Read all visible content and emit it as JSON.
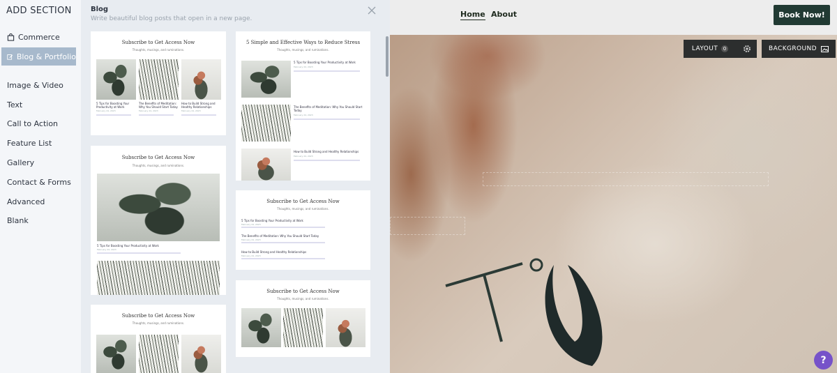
{
  "sidebar": {
    "title": "ADD SECTION",
    "items": [
      {
        "label": "Commerce",
        "icon": "bag-icon"
      },
      {
        "label": "Blog & Portfolio",
        "icon": "edit-icon",
        "active": true
      },
      {
        "label": "Image & Video"
      },
      {
        "label": "Text"
      },
      {
        "label": "Call to Action"
      },
      {
        "label": "Feature List"
      },
      {
        "label": "Gallery"
      },
      {
        "label": "Contact & Forms"
      },
      {
        "label": "Advanced"
      },
      {
        "label": "Blank"
      }
    ]
  },
  "panel": {
    "title": "Blog",
    "subtitle": "Write beautiful blog posts that open in a new page.",
    "cards": {
      "c1": {
        "title": "Subscribe to Get Access Now",
        "sub": "Thoughts, musings, and ruminations.",
        "posts": [
          {
            "title": "5 Tips for Boosting Your Productivity at Work",
            "date": "February 24, 2023"
          },
          {
            "title": "The Benefits of Meditation: Why You Should Start Today",
            "date": "February 24, 2023"
          },
          {
            "title": "How to Build Strong and Healthy Relationships",
            "date": "February 24, 2023"
          }
        ]
      },
      "c2": {
        "title": "5 Simple and Effective Ways to Reduce Stress",
        "sub": "Thoughts, musings, and ruminations.",
        "posts": [
          {
            "title": "5 Tips for Boosting Your Productivity at Work",
            "date": "February 24, 2023"
          },
          {
            "title": "The Benefits of Meditation: Why You Should Start Today",
            "date": "February 24, 2023"
          },
          {
            "title": "How to Build Strong and Healthy Relationships",
            "date": "February 24, 2023"
          }
        ]
      },
      "c3": {
        "title": "Subscribe to Get Access Now",
        "sub": "Thoughts, musings, and ruminations.",
        "post": {
          "title": "5 Tips for Boosting Your Productivity at Work",
          "date": "February 24, 2023"
        }
      },
      "c4": {
        "title": "Subscribe to Get Access Now",
        "sub": "Thoughts, musings, and ruminations.",
        "posts": [
          {
            "title": "5 Tips for Boosting Your Productivity at Work",
            "date": "February 24, 2023"
          },
          {
            "title": "The Benefits of Meditation: Why You Should Start Today",
            "date": "February 24, 2023"
          },
          {
            "title": "How to Build Strong and Healthy Relationships",
            "date": "February 24, 2023"
          }
        ]
      },
      "c5": {
        "title": "Subscribe to Get Access Now",
        "sub": "Thoughts, musings, and ruminations."
      },
      "c6": {
        "title": "Subscribe to Get Access Now",
        "sub": "Thoughts, musings, and ruminations."
      }
    }
  },
  "site": {
    "nav": {
      "home": "Home",
      "about": "About"
    },
    "book_label": "Book Now!",
    "layout_label": "LAYOUT",
    "layout_count": "0",
    "background_label": "BACKGROUND",
    "help_label": "?"
  },
  "colors": {
    "accent": "#213a33",
    "help": "#7652c9",
    "active_item": "#a7b9cc"
  }
}
